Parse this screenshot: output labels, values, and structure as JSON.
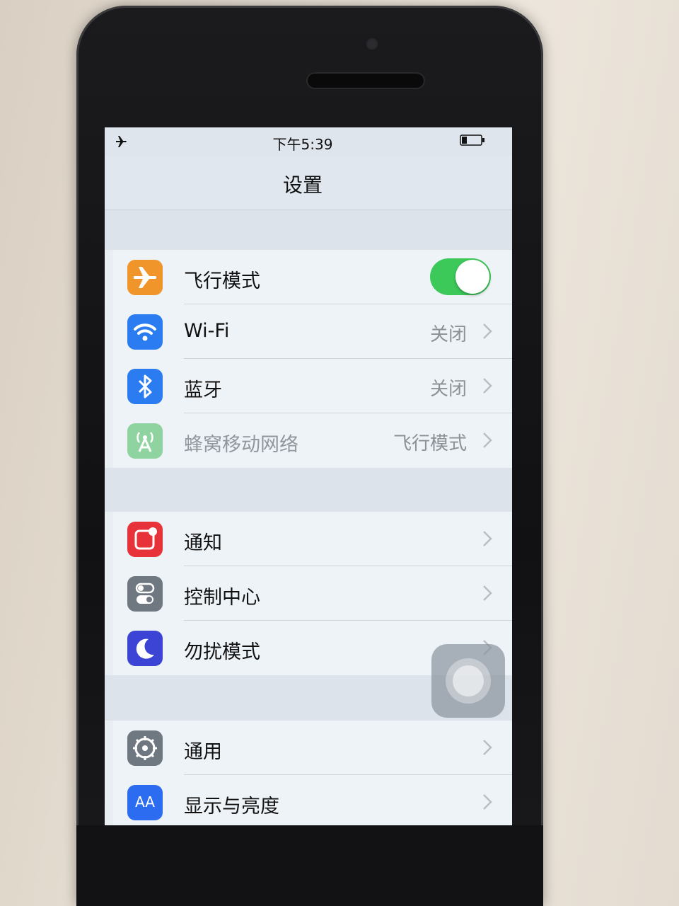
{
  "status_bar": {
    "time": "下午5:39",
    "airplane_icon": "airplane-icon",
    "battery_icon": "battery-icon"
  },
  "nav": {
    "title": "设置"
  },
  "groups": [
    {
      "rows": [
        {
          "label": "飞行模式",
          "icon": "airplane-icon",
          "icon_color": "#f0952a",
          "control": "toggle",
          "toggle_on": true
        },
        {
          "label": "Wi-Fi",
          "icon": "wifi-icon",
          "icon_color": "#2b7cf0",
          "value": "关闭"
        },
        {
          "label": "蓝牙",
          "icon": "bluetooth-icon",
          "icon_color": "#2b7cf0",
          "value": "关闭"
        },
        {
          "label": "蜂窝移动网络",
          "icon": "cellular-icon",
          "icon_color": "#8fd3a0",
          "value": "飞行模式",
          "dimmed": true
        }
      ]
    },
    {
      "rows": [
        {
          "label": "通知",
          "icon": "notifications-icon",
          "icon_color": "#e8323a"
        },
        {
          "label": "控制中心",
          "icon": "control-center-icon",
          "icon_color": "#6f7780"
        },
        {
          "label": "勿扰模式",
          "icon": "moon-icon",
          "icon_color": "#3b44d4"
        }
      ]
    },
    {
      "rows": [
        {
          "label": "通用",
          "icon": "gear-icon",
          "icon_color": "#6f7780"
        },
        {
          "label": "显示与亮度",
          "icon": "display-icon",
          "icon_color": "#2b6cf0",
          "icon_text": "AA"
        }
      ]
    }
  ],
  "colors": {
    "toggle_on": "#3dc95a",
    "chevron": "#b9bec5"
  },
  "assistive_touch": {
    "icon": "assistive-touch-icon"
  }
}
